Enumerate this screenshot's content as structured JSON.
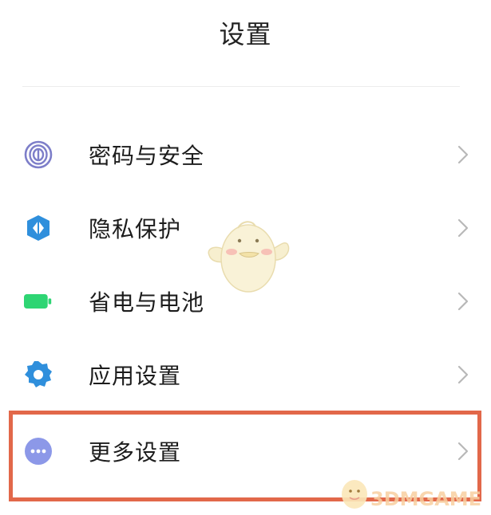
{
  "header": {
    "title": "设置"
  },
  "settings": {
    "items": [
      {
        "label": "密码与安全",
        "icon": "fingerprint-icon",
        "color": "#7d7ec9"
      },
      {
        "label": "隐私保护",
        "icon": "privacy-shield-icon",
        "color": "#2f8fdc"
      },
      {
        "label": "省电与电池",
        "icon": "battery-icon",
        "color": "#2ed573"
      },
      {
        "label": "应用设置",
        "icon": "gear-icon",
        "color": "#2f8fdc"
      },
      {
        "label": "更多设置",
        "icon": "more-dots-icon",
        "color": "#8c98e8"
      }
    ],
    "highlight_color": "#e2684a"
  },
  "watermark": {
    "text": "3DMGAME"
  }
}
